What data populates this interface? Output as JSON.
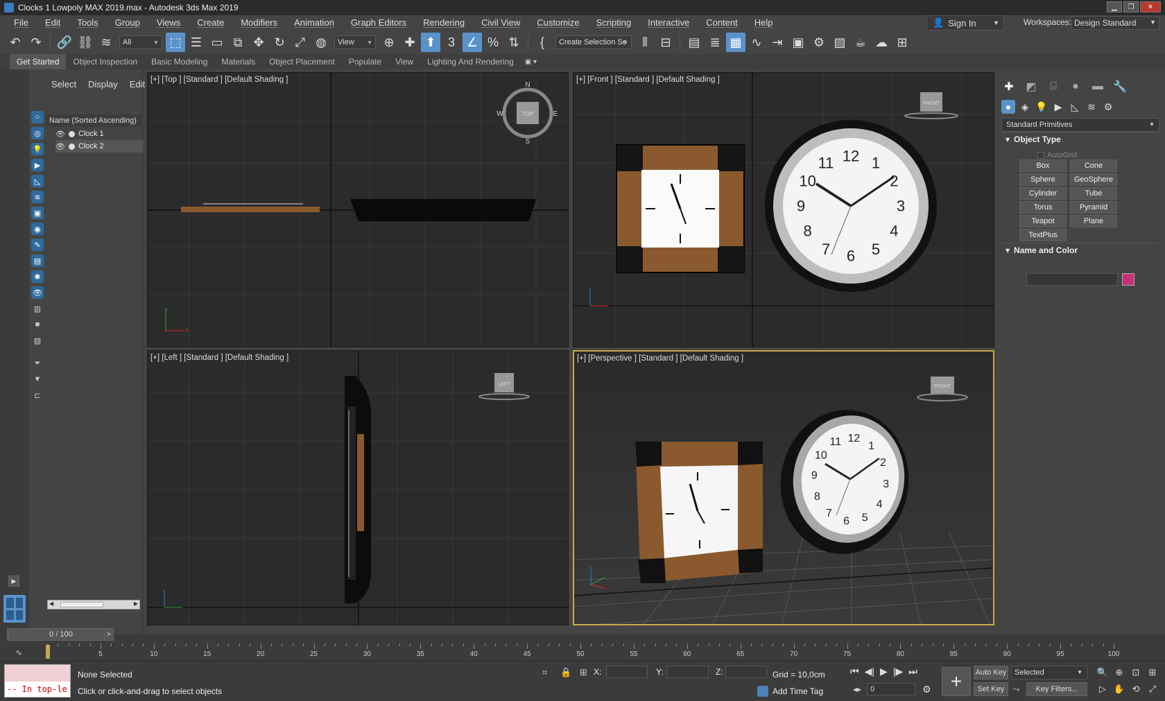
{
  "window": {
    "title": "Clocks 1 Lowpoly MAX 2019.max - Autodesk 3ds Max 2019"
  },
  "menu": [
    "File",
    "Edit",
    "Tools",
    "Group",
    "Views",
    "Create",
    "Modifiers",
    "Animation",
    "Graph Editors",
    "Rendering",
    "Civil View",
    "Customize",
    "Scripting",
    "Interactive",
    "Content",
    "Help"
  ],
  "header": {
    "sign_in": "Sign In",
    "workspaces_label": "Workspaces:",
    "workspace": "Design Standard"
  },
  "toolbar": {
    "filter": "All",
    "ref_coord": "View",
    "selection_set": "Create Selection Se"
  },
  "ribbon": {
    "tabs": [
      "Get Started",
      "Object Inspection",
      "Basic Modeling",
      "Materials",
      "Object Placement",
      "Populate",
      "View",
      "Lighting And Rendering"
    ],
    "active": "Get Started"
  },
  "scene_explorer": {
    "tabs": [
      "Select",
      "Display",
      "Edit"
    ],
    "column_header": "Name (Sorted Ascending)",
    "items": [
      "Clock 1",
      "Clock 2"
    ]
  },
  "viewports": [
    {
      "label": "[+] [Top ] [Standard ] [Default Shading ]",
      "cube": "TOP",
      "compass": [
        "N",
        "E",
        "S",
        "W"
      ]
    },
    {
      "label": "[+] [Front ] [Standard ] [Default Shading ]",
      "cube": "FRONT"
    },
    {
      "label": "[+] [Left ] [Standard ] [Default Shading ]",
      "cube": "LEFT"
    },
    {
      "label": "[+] [Perspective ] [Standard ] [Default Shading ]",
      "cube": "FRONT",
      "active": true
    }
  ],
  "clock_numbers": [
    "12",
    "1",
    "2",
    "3",
    "4",
    "5",
    "6",
    "7",
    "8",
    "9",
    "10",
    "11"
  ],
  "timeline": {
    "frame_display": "0 / 100",
    "ticks": [
      0,
      5,
      10,
      15,
      20,
      25,
      30,
      35,
      40,
      45,
      50,
      55,
      60,
      65,
      70,
      75,
      80,
      85,
      90,
      95,
      100
    ]
  },
  "status": {
    "selection": "None Selected",
    "hint": "Click or click-and-drag to select objects",
    "maxscript": "-- In top-le",
    "x_label": "X:",
    "y_label": "Y:",
    "z_label": "Z:",
    "grid": "Grid = 10,0cm",
    "add_time_tag": "Add Time Tag",
    "current_frame": "0",
    "auto_key": "Auto Key",
    "set_key": "Set Key",
    "key_mode": "Selected",
    "key_filters": "Key Filters..."
  },
  "command_panel": {
    "category": "Standard Primitives",
    "object_type_title": "Object Type",
    "autogrid": "AutoGrid",
    "primitives": [
      "Box",
      "Cone",
      "Sphere",
      "GeoSphere",
      "Cylinder",
      "Tube",
      "Torus",
      "Pyramid",
      "Teapot",
      "Plane",
      "TextPlus"
    ],
    "name_color_title": "Name and Color",
    "color": "#c8307a"
  },
  "colors": {
    "accent": "#5a93c9",
    "active_viewport": "#c9a84a",
    "wood": "#8a5a2e"
  }
}
